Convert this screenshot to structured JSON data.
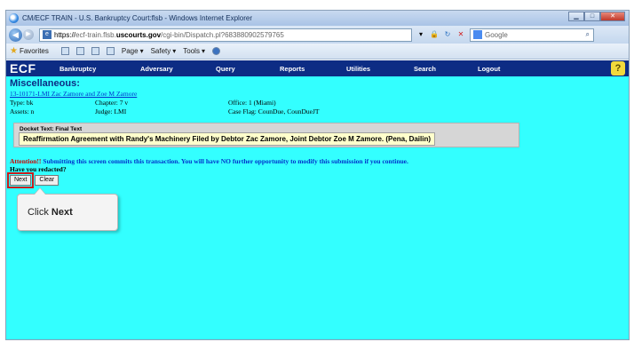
{
  "browser": {
    "title": "CM/ECF TRAIN - U.S. Bankruptcy Court:flsb - Windows Internet Explorer",
    "window_controls": [
      "minimize",
      "maximize",
      "close"
    ],
    "address": {
      "scheme": "https://",
      "pre_host": "ecf-train.flsb.",
      "host": "uscourts.gov",
      "rest": "/cgi-bin/Dispatch.pl?683880902579765"
    },
    "search_placeholder": "Google",
    "favorites_label": "Favorites",
    "commands": [
      "Page",
      "Safety",
      "Tools"
    ]
  },
  "ecf": {
    "logo": "ECF",
    "nav": [
      "Bankruptcy",
      "Adversary",
      "Query",
      "Reports",
      "Utilities",
      "Search",
      "Logout"
    ],
    "help_label": "?"
  },
  "page": {
    "title": "Miscellaneous:",
    "case_link": "13-10171-LMI Zac Zamore and Zoe M Zamore",
    "type": "Type: bk",
    "chapter": "Chapter: 7 v",
    "office": "Office: 1 (Miami)",
    "assets": "Assets: n",
    "judge": "Judge: LMI",
    "case_flag": "Case Flag: CounDue, CounDueJT"
  },
  "docket": {
    "label": "Docket Text: Final Text",
    "text": "Reaffirmation Agreement with Randy's Machinery Filed by Debtor Zac Zamore, Joint Debtor Zoe M Zamore. (Pena, Dailin)"
  },
  "attention": {
    "prefix": "Attention!!",
    "message": " Submitting this screen commits this transaction. You will have NO further opportunity to modify this submission if you continue."
  },
  "redacted_question": "Have you redacted?",
  "buttons": {
    "next": "Next",
    "clear": "Clear"
  },
  "callout": {
    "prefix": "Click ",
    "bold": "Next"
  },
  "colors": {
    "app_bg": "#33ffff",
    "nav_bg": "#0d2c84",
    "docket_highlight": "#ffffcc",
    "attention_red": "#cc0000"
  }
}
